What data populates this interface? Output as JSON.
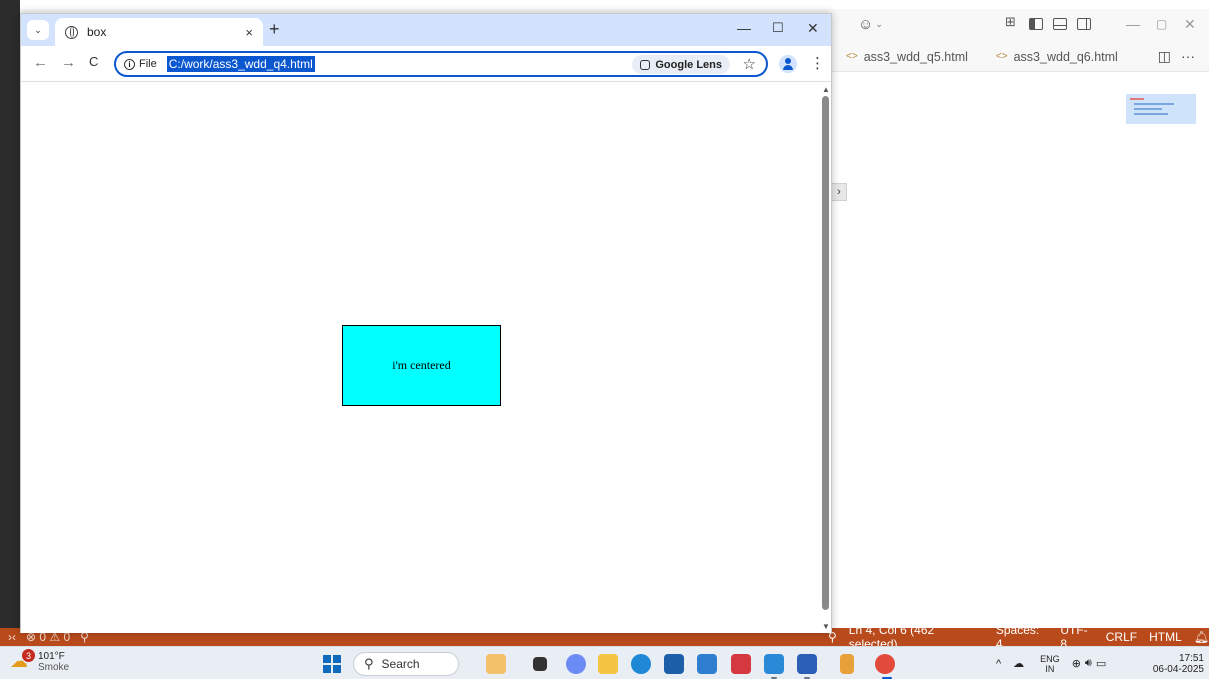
{
  "browser": {
    "tab_title": "box",
    "new_tab_symbol": "+",
    "tab_close_symbol": "×",
    "tab_search_symbol": "⌄",
    "minimize_symbol": "—",
    "maximize_symbol": "☐",
    "close_symbol": "✕",
    "back_symbol": "←",
    "forward_symbol": "→",
    "reload_symbol": "C",
    "scheme_label": "File",
    "url": "C:/work/ass3_wdd_q4.html",
    "lens_label": "Google Lens",
    "star_symbol": "☆",
    "menu_symbol": "⋮"
  },
  "page": {
    "box_text": "i'm centered",
    "box_color": "#00ffff"
  },
  "vscode": {
    "tabs": [
      {
        "label": "ass3_wdd_q5.html"
      },
      {
        "label": "ass3_wdd_q6.html"
      }
    ],
    "tab_icon": "<>",
    "more_symbol": "···",
    "status": {
      "problems": "⊗ 0 ⚠ 0",
      "position": "Ln 4, Col 6 (462 selected)",
      "spaces": "Spaces: 4",
      "encoding": "UTF-8",
      "eol": "CRLF",
      "language": "HTML"
    },
    "status_color": "#b84a1b"
  },
  "taskbar": {
    "weather_temp": "101°F",
    "weather_desc": "Smoke",
    "weather_badge": "3",
    "search_label": "Search",
    "lang_line1": "ENG",
    "lang_line2": "IN",
    "time": "17:51",
    "date": "06-04-2025"
  }
}
